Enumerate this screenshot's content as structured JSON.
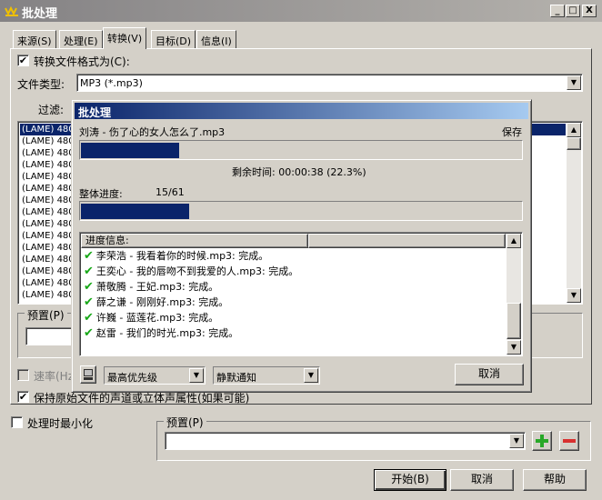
{
  "window": {
    "title": "批处理",
    "min": "_",
    "max": "□",
    "close": "X"
  },
  "tabs": [
    {
      "label": "来源(S)"
    },
    {
      "label": "处理(E)"
    },
    {
      "label": "转换(V)"
    },
    {
      "label": "目标(D)"
    },
    {
      "label": "信息(I)"
    }
  ],
  "convert": {
    "enable_label": "转换文件格式为(C):",
    "enable_checked": "✔",
    "file_type_label": "文件类型:",
    "file_type_value": "MP3 (*.mp3)",
    "filter_label": "过滤:",
    "format_items": [
      "(LAME) 480",
      "(LAME) 480",
      "(LAME) 480",
      "(LAME) 480",
      "(LAME) 480",
      "(LAME) 480",
      "(LAME) 480",
      "(LAME) 480",
      "(LAME) 480",
      "(LAME) 480",
      "(LAME) 480",
      "(LAME) 480",
      "(LAME) 480",
      "(LAME) 480",
      "(LAME) 480"
    ],
    "preset_label": "预置(P)",
    "rate_label": "速率(Hz",
    "keep_label": "保持原始文件的声道或立体声属性(如果可能)",
    "keep_checked": "✔"
  },
  "bottom": {
    "minimize_label": "处理时最小化",
    "preset_label": "预置(P)",
    "preset_value": "",
    "start": "开始(B)",
    "cancel": "取消",
    "help": "帮助"
  },
  "progress": {
    "title": "批处理",
    "current_file": "刘涛 - 伤了心的女人怎么了.mp3",
    "status": "保存",
    "file_progress": 0.223,
    "remaining_label": "剩余时间:",
    "remaining_value": "00:00:38 (22.3%)",
    "overall_label": "整体进度:",
    "overall_count": "15/61",
    "overall_progress": 0.246,
    "log_header": "进度信息:",
    "log": [
      "李荣浩 - 我看着你的时候.mp3: 完成。",
      "王奕心 - 我的唇吻不到我爱的人.mp3: 完成。",
      "萧敬腾 - 王妃.mp3: 完成。",
      "薛之谦 - 刚刚好.mp3: 完成。",
      "许巍 - 蓝莲花.mp3: 完成。",
      "赵雷 - 我们的时光.mp3: 完成。"
    ],
    "priority_value": "最高优先级",
    "notify_value": "静默通知",
    "cancel": "取消"
  }
}
